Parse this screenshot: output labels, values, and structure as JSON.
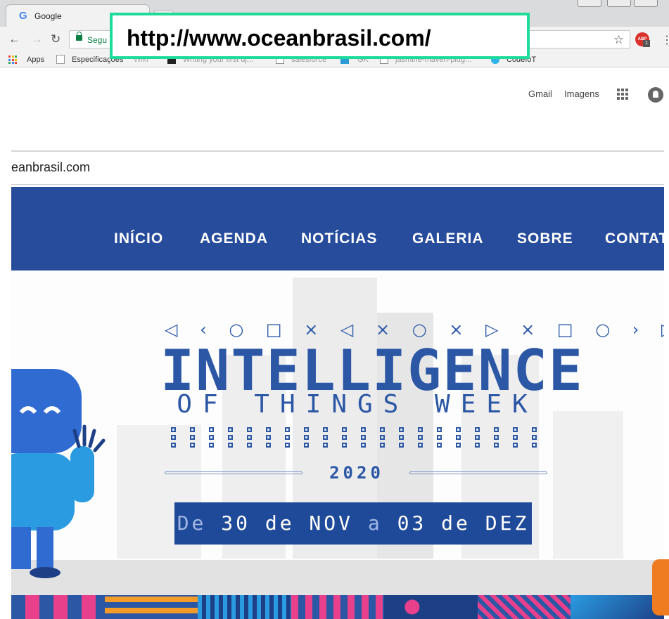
{
  "browser": {
    "tab_title": "Google",
    "tab_icon": "G",
    "secure_label": "Segu",
    "omnibox_url_callout": "http://www.oceanbrasil.com/",
    "bookmarks": [
      {
        "label": "Apps"
      },
      {
        "label": "Especificações"
      },
      {
        "label": "Wiki"
      },
      {
        "label": "Writing your first dj..."
      },
      {
        "label": "salesforce"
      },
      {
        "label": "GK"
      },
      {
        "label": "jasmine-maven-plug..."
      },
      {
        "label": "CodeIoT"
      }
    ],
    "abp_badge": "ABP",
    "abp_count": "1"
  },
  "google_bar": {
    "gmail": "Gmail",
    "images": "Imagens"
  },
  "site": {
    "url_text": "eanbrasil.com",
    "nav": [
      "INÍCIO",
      "AGENDA",
      "NOTÍCIAS",
      "GALERIA",
      "SOBRE",
      "CONTAT"
    ],
    "hero": {
      "shapes": "◁ ‹ ○ □ × ◁ × ○ × ▷ × □ ○ › ▷",
      "title_line1": "INTELLIGENCE",
      "title_line2": "OF THINGS WEEK",
      "year": "2020",
      "date_prefix": "De ",
      "date_start": "30 de NOV",
      "date_mid": " a ",
      "date_end": "03 de DEZ"
    }
  },
  "colors": {
    "nav_bg": "#264c9b",
    "title_blue": "#2b57a5",
    "banner_bg": "#1f4a99",
    "callout_border": "#1fdb9a",
    "secure_green": "#0b8043"
  }
}
